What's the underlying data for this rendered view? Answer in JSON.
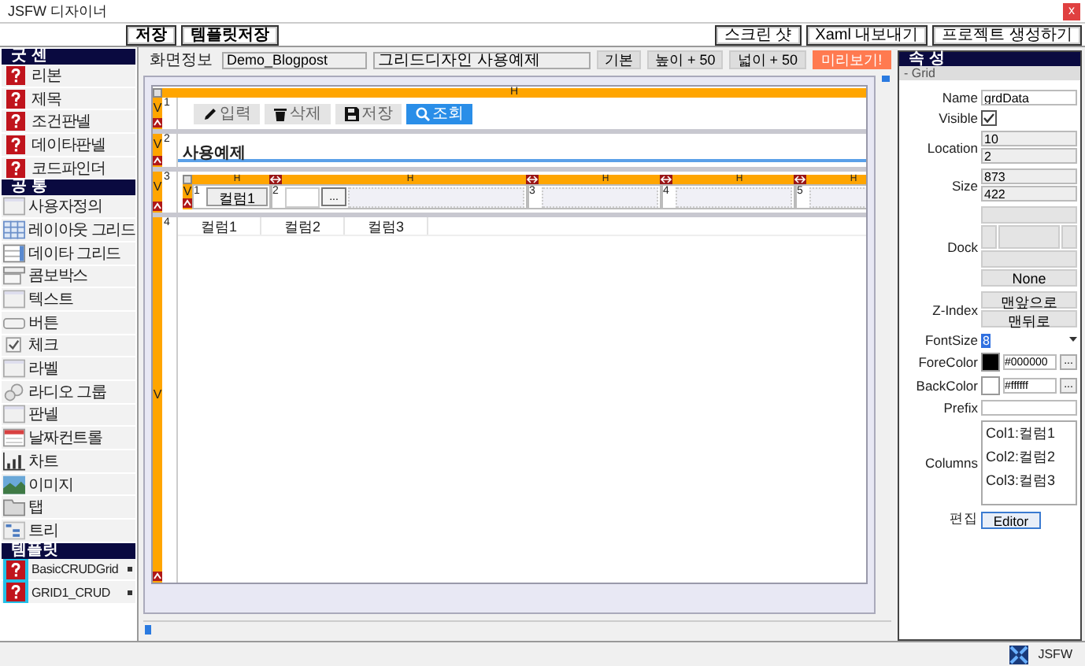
{
  "window": {
    "title": "JSFW 디자이너",
    "close": "x"
  },
  "toolbar": {
    "left": [
      "저장",
      "템플릿저장"
    ],
    "right": [
      "스크린 샷",
      "Xaml 내보내기",
      "프로젝트 생성하기"
    ]
  },
  "sidebar": {
    "sections": [
      {
        "title": "굿 센",
        "kind": "custom",
        "items": [
          {
            "label": "리본"
          },
          {
            "label": "제목"
          },
          {
            "label": "조건판넬"
          },
          {
            "label": "데이타판넬"
          },
          {
            "label": "코드파인더"
          }
        ]
      },
      {
        "title": "공 통",
        "kind": "common",
        "items": [
          {
            "label": "사용자정의"
          },
          {
            "label": "레이아웃 그리드"
          },
          {
            "label": "데이타 그리드"
          },
          {
            "label": "콤보박스"
          },
          {
            "label": "텍스트"
          },
          {
            "label": "버튼"
          },
          {
            "label": "체크"
          },
          {
            "label": "라벨"
          },
          {
            "label": "라디오 그룹"
          },
          {
            "label": "판넬"
          },
          {
            "label": "날짜컨트롤"
          },
          {
            "label": "차트"
          },
          {
            "label": "이미지"
          },
          {
            "label": "탭"
          },
          {
            "label": "트리"
          }
        ]
      },
      {
        "title": "템플릿",
        "kind": "template",
        "items": [
          {
            "label": "BasicCRUDGrid"
          },
          {
            "label": "GRID1_CRUD"
          }
        ]
      }
    ]
  },
  "screen_info": {
    "label": "화면정보",
    "name": "Demo_Blogpost",
    "title": "그리드디자인 사용예제",
    "buttons": [
      {
        "label": "기본",
        "kind": "normal"
      },
      {
        "label": "높이 + 50",
        "kind": "normal"
      },
      {
        "label": "넓이 + 50",
        "kind": "normal"
      },
      {
        "label": "미리보기!",
        "kind": "accent"
      }
    ]
  },
  "canvas": {
    "top_marker": "H",
    "rows": [
      {
        "number": "1",
        "marker": "V",
        "kind": "toolbar",
        "buttons": [
          {
            "label": "입력",
            "disabled": true
          },
          {
            "label": "삭제",
            "disabled": true
          },
          {
            "label": "저장",
            "disabled": true
          },
          {
            "label": "조회",
            "disabled": false
          }
        ]
      },
      {
        "number": "2",
        "marker": "V",
        "kind": "title",
        "text": "사용예제"
      },
      {
        "number": "3",
        "marker": "V",
        "kind": "grid",
        "row_marker": "V",
        "cells": [
          {
            "marker": "H",
            "number": "1",
            "kind": "button",
            "label": "컬럼1"
          },
          {
            "marker": "H",
            "number": "2",
            "kind": "picker",
            "button": "..."
          },
          {
            "marker": "H",
            "number": "3",
            "kind": "empty"
          },
          {
            "marker": "H",
            "number": "4",
            "kind": "empty"
          },
          {
            "marker": "H",
            "number": "5",
            "kind": "empty"
          }
        ]
      },
      {
        "number": "4",
        "marker": "V",
        "kind": "table",
        "columns": [
          "컬럼1",
          "컬럼2",
          "컬럼3"
        ]
      }
    ]
  },
  "properties": {
    "title": "속 성",
    "section": "- Grid",
    "rows": [
      {
        "label": "Name",
        "kind": "text",
        "value": "grdData"
      },
      {
        "label": "Visible",
        "kind": "check",
        "checked": true
      },
      {
        "label": "Location",
        "kind": "pair",
        "values": [
          "10",
          "2"
        ]
      },
      {
        "label": "Size",
        "kind": "pair",
        "values": [
          "873",
          "422"
        ]
      },
      {
        "label": "Dock",
        "kind": "dock",
        "value": "None"
      },
      {
        "label": "Z-Index",
        "kind": "buttons",
        "buttons": [
          "맨앞으로",
          "맨뒤로"
        ]
      },
      {
        "label": "FontSize",
        "kind": "select",
        "value": "8"
      },
      {
        "label": "ForeColor",
        "kind": "color",
        "value": "#000000",
        "button": "..."
      },
      {
        "label": "BackColor",
        "kind": "color",
        "value": "#ffffff",
        "button": "..."
      },
      {
        "label": "Prefix",
        "kind": "text"
      },
      {
        "label": "Columns",
        "kind": "list",
        "items": [
          "Col1:컬럼1",
          "Col2:컬럼2",
          "Col3:컬럼3"
        ]
      },
      {
        "label": "편집",
        "kind": "button",
        "button": "Editor"
      }
    ]
  },
  "status_bar": {
    "label": "JSFW"
  }
}
